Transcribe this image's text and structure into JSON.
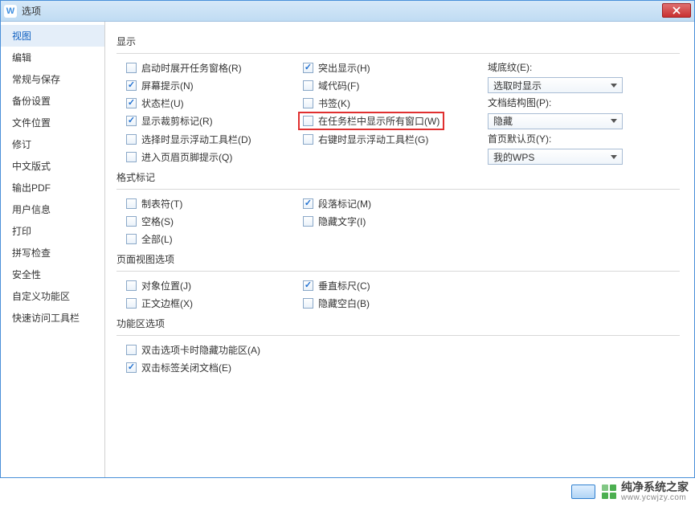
{
  "window": {
    "title": "选项"
  },
  "sidebar": {
    "items": [
      {
        "label": "视图",
        "selected": true
      },
      {
        "label": "编辑"
      },
      {
        "label": "常规与保存"
      },
      {
        "label": "备份设置"
      },
      {
        "label": "文件位置"
      },
      {
        "label": "修订"
      },
      {
        "label": "中文版式"
      },
      {
        "label": "输出PDF"
      },
      {
        "label": "用户信息"
      },
      {
        "label": "打印"
      },
      {
        "label": "拼写检查"
      },
      {
        "label": "安全性"
      },
      {
        "label": "自定义功能区"
      },
      {
        "label": "快速访问工具栏"
      }
    ]
  },
  "sections": {
    "display": {
      "title": "显示",
      "startup_pane": {
        "label": "启动时展开任务窗格(R)",
        "checked": false
      },
      "screen_tips": {
        "label": "屏幕提示(N)",
        "checked": true
      },
      "status_bar": {
        "label": "状态栏(U)",
        "checked": true
      },
      "crop_marks": {
        "label": "显示裁剪标记(R)",
        "checked": true
      },
      "float_toolbar_select": {
        "label": "选择时显示浮动工具栏(D)",
        "checked": false
      },
      "enter_header_hint": {
        "label": "进入页眉页脚提示(Q)",
        "checked": false
      },
      "highlight": {
        "label": "突出显示(H)",
        "checked": true
      },
      "field_codes": {
        "label": "域代码(F)",
        "checked": false
      },
      "bookmarks": {
        "label": "书签(K)",
        "checked": false
      },
      "show_all_taskbar": {
        "label": "在任务栏中显示所有窗口(W)",
        "checked": false
      },
      "float_toolbar_right": {
        "label": "右键时显示浮动工具栏(G)",
        "checked": false
      },
      "field_shading": {
        "label": "域底纹(E):",
        "value": "选取时显示"
      },
      "doc_map": {
        "label": "文档结构图(P):",
        "value": "隐藏"
      },
      "home_default": {
        "label": "首页默认页(Y):",
        "value": "我的WPS"
      }
    },
    "format_marks": {
      "title": "格式标记",
      "tabs": {
        "label": "制表符(T)",
        "checked": false
      },
      "spaces": {
        "label": "空格(S)",
        "checked": false
      },
      "all": {
        "label": "全部(L)",
        "checked": false
      },
      "para_marks": {
        "label": "段落标记(M)",
        "checked": true
      },
      "hidden_text": {
        "label": "隐藏文字(I)",
        "checked": false
      }
    },
    "page_view": {
      "title": "页面视图选项",
      "object_pos": {
        "label": "对象位置(J)",
        "checked": false
      },
      "text_border": {
        "label": "正文边框(X)",
        "checked": false
      },
      "vruler": {
        "label": "垂直标尺(C)",
        "checked": true
      },
      "hide_blank": {
        "label": "隐藏空白(B)",
        "checked": false
      }
    },
    "ribbon": {
      "title": "功能区选项",
      "dblclick_hide": {
        "label": "双击选项卡时隐藏功能区(A)",
        "checked": false
      },
      "dblclick_close": {
        "label": "双击标签关闭文档(E)",
        "checked": true
      }
    }
  },
  "watermark": {
    "main": "纯净系统之家",
    "sub": "www.ycwjzy.com"
  }
}
